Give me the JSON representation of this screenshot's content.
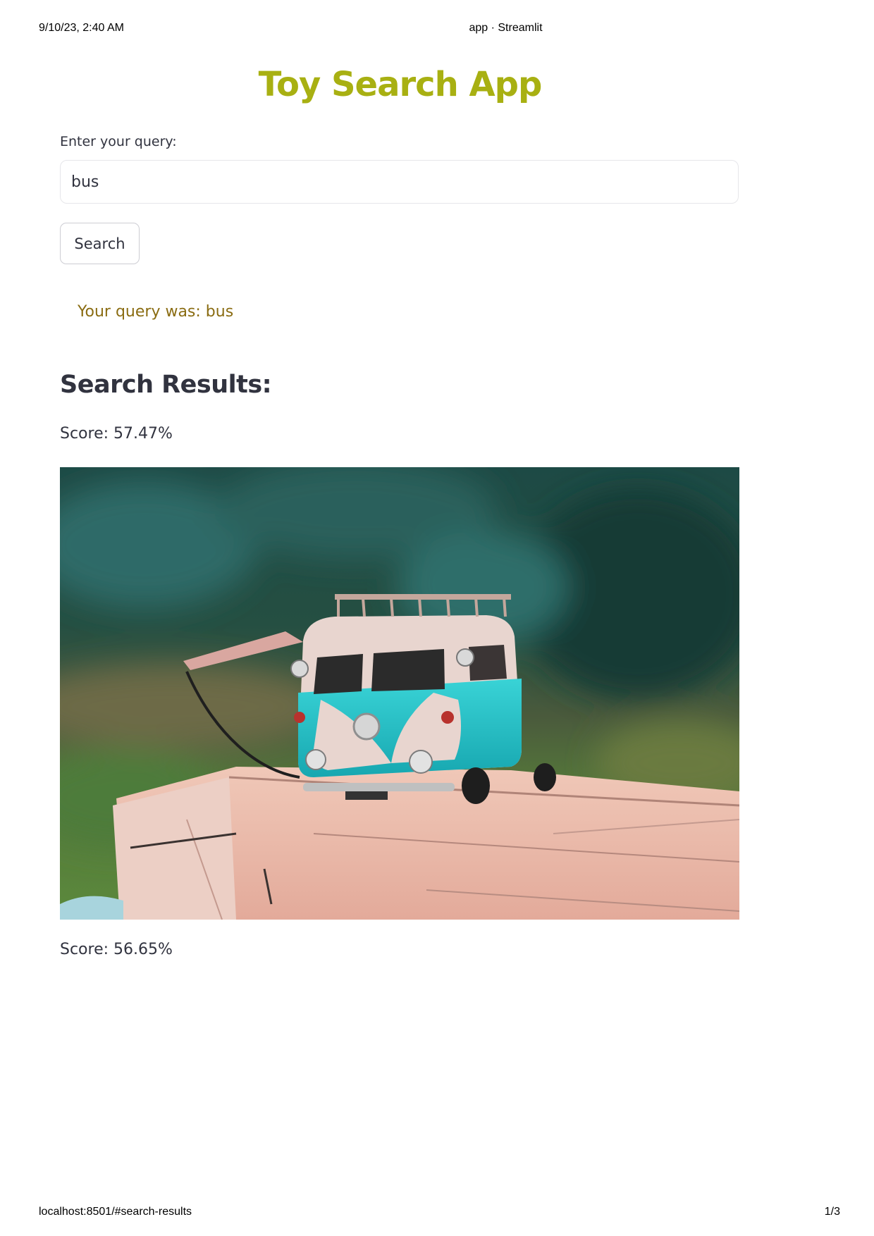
{
  "print_header": {
    "datetime": "9/10/23, 2:40 AM",
    "page_title": "app · Streamlit"
  },
  "print_footer": {
    "url": "localhost:8501/#search-results",
    "page_number": "1/3"
  },
  "app": {
    "title": "Toy Search App",
    "title_color": "#a8b012"
  },
  "query": {
    "label": "Enter your query:",
    "value": "bus"
  },
  "search_button": {
    "label": "Search"
  },
  "query_echo": {
    "text": "Your query was: bus",
    "color": "#8a6c12"
  },
  "results": {
    "heading": "Search Results:",
    "items": [
      {
        "score": "Score: 57.47%",
        "image_subject": "toy-vw-bus-on-wooden-crate"
      },
      {
        "score": "Score: 56.65%"
      }
    ]
  }
}
